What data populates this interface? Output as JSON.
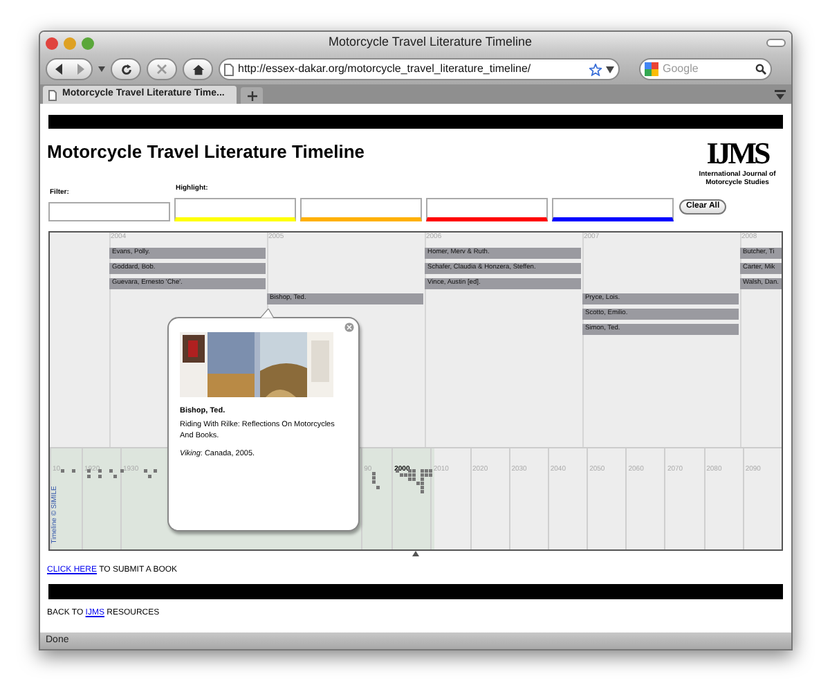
{
  "window": {
    "title": "Motorcycle Travel Literature Timeline"
  },
  "toolbar": {
    "url": "http://essex-dakar.org/motorcycle_travel_literature_timeline/",
    "search_placeholder": "Google"
  },
  "tabs": [
    {
      "label": "Motorcycle Travel Literature Time...",
      "selected": true
    }
  ],
  "page": {
    "heading": "Motorcycle Travel Literature Timeline",
    "logo": {
      "letters": "IJMS",
      "caption": "International Journal of Motorcycle Studies"
    },
    "filter": {
      "label": "Filter:"
    },
    "highlight": {
      "label": "Highlight:",
      "fields": [
        {
          "color": "#ffff00"
        },
        {
          "color": "#ffb000"
        },
        {
          "color": "#ff0000"
        },
        {
          "color": "#0000ff"
        }
      ]
    },
    "clear_button": "Clear All"
  },
  "timeline": {
    "years": [
      {
        "label": "2004",
        "events": [
          "Evans, Polly.",
          "Goddard, Bob.",
          "Guevara, Ernesto 'Che'."
        ]
      },
      {
        "label": "2005",
        "events": [
          "Bishop, Ted."
        ]
      },
      {
        "label": "2006",
        "events": [
          "Homer, Merv & Ruth.",
          "Schafer, Claudia & Honzera, Steffen.",
          "Vince, Austin [ed]."
        ]
      },
      {
        "label": "2007",
        "events": [
          "Pryce, Lois.",
          "Scotto, Emilio.",
          "Simon, Ted."
        ]
      },
      {
        "label": "2008",
        "events": [
          "Butcher, Ti",
          "Carter, Mik",
          "Walsh, Dan."
        ]
      }
    ],
    "decades_left": [
      {
        "label": "10",
        "current": false
      },
      {
        "label": "1920",
        "current": false
      },
      {
        "label": "1930",
        "current": false
      }
    ],
    "decades_right": [
      {
        "label": "90",
        "current": false
      },
      {
        "label": "2000",
        "current": true
      },
      {
        "label": "2010",
        "current": false
      },
      {
        "label": "2020",
        "current": false
      },
      {
        "label": "2030",
        "current": false
      },
      {
        "label": "2040",
        "current": false
      },
      {
        "label": "2050",
        "current": false
      },
      {
        "label": "2060",
        "current": false
      },
      {
        "label": "2070",
        "current": false
      },
      {
        "label": "2080",
        "current": false
      },
      {
        "label": "2090",
        "current": false
      }
    ],
    "credit": "Timeline © SIMILE",
    "popup": {
      "author": "Bishop, Ted.",
      "title": "Riding With Rilke: Reflections On Motorcycles And Books.",
      "publisher": "*Viking*: Canada, 2005."
    }
  },
  "submit": {
    "link": "CLICK HERE",
    "text": "TO SUBMIT A BOOK"
  },
  "footer": {
    "before": "BACK TO",
    "link": "IJMS",
    "after": "RESOURCES"
  },
  "status_bar": "Done"
}
